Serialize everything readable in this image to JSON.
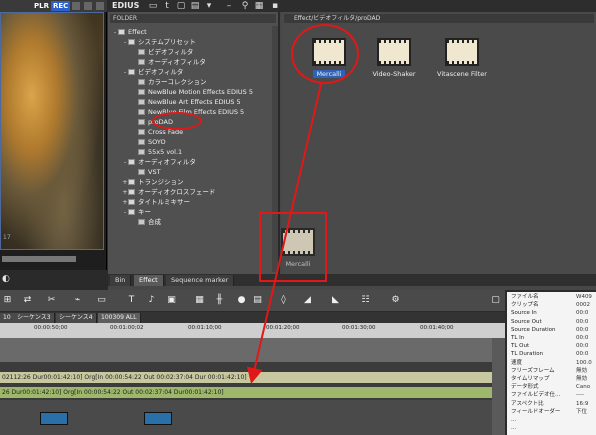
{
  "player": {
    "plr_label": "PLR",
    "rec_label": "REC",
    "frame_number": "17"
  },
  "app": {
    "title": "EDIUS"
  },
  "folder_pane": {
    "header": "FOLDER",
    "items": [
      {
        "label": "Effect",
        "indent": 0,
        "expander": "-"
      },
      {
        "label": "システムプリセット",
        "indent": 1,
        "expander": "-"
      },
      {
        "label": "ビデオフィルタ",
        "indent": 2,
        "expander": ""
      },
      {
        "label": "オーディオフィルタ",
        "indent": 2,
        "expander": ""
      },
      {
        "label": "ビデオフィルタ",
        "indent": 1,
        "expander": "-"
      },
      {
        "label": "カラーコレクション",
        "indent": 2,
        "expander": ""
      },
      {
        "label": "NewBlue Motion Effects EDIUS 5",
        "indent": 2,
        "expander": ""
      },
      {
        "label": "NewBlue Art Effects EDIUS 5",
        "indent": 2,
        "expander": ""
      },
      {
        "label": "NewBlue Film Effects EDIUS 5",
        "indent": 2,
        "expander": ""
      },
      {
        "label": "proDAD",
        "indent": 2,
        "expander": ""
      },
      {
        "label": "Cross Fade",
        "indent": 2,
        "expander": ""
      },
      {
        "label": "SOYO",
        "indent": 2,
        "expander": ""
      },
      {
        "label": "55x5 vol.1",
        "indent": 2,
        "expander": ""
      },
      {
        "label": "オーディオフィルタ",
        "indent": 1,
        "expander": "-"
      },
      {
        "label": "VST",
        "indent": 2,
        "expander": ""
      },
      {
        "label": "トランジション",
        "indent": 1,
        "expander": "+"
      },
      {
        "label": "オーディオクロスフェード",
        "indent": 1,
        "expander": "+"
      },
      {
        "label": "タイトルミキサー",
        "indent": 1,
        "expander": "+"
      },
      {
        "label": "キー",
        "indent": 1,
        "expander": "-"
      },
      {
        "label": "合成",
        "indent": 2,
        "expander": ""
      }
    ]
  },
  "effects_pane": {
    "path": "Effect/ビデオフィルタ/proDAD",
    "items": [
      {
        "label": "Mercalli",
        "selected": true
      },
      {
        "label": "Video-Shaker",
        "selected": false
      },
      {
        "label": "Vitascene Filter",
        "selected": false
      }
    ],
    "drag_ghost_label": "Mercalli"
  },
  "bin_tabs": [
    {
      "label": "Bin",
      "active": false
    },
    {
      "label": "Effect",
      "active": true
    },
    {
      "label": "Sequence marker",
      "active": false
    }
  ],
  "timeline": {
    "sequence_tabs": [
      {
        "label": "10",
        "active": false
      },
      {
        "label": "シーケンス3",
        "active": false
      },
      {
        "label": "シーケンス4",
        "active": false
      },
      {
        "label": "100309 ALL",
        "active": true
      }
    ],
    "ruler_ticks": [
      "00:00:50;00",
      "00:01:00;02",
      "00:01:10;00",
      "00:01:20;00",
      "00:01:30;00",
      "00:01:40;00"
    ],
    "video_clip_text": "02112:26 Dur00:01:42:10]  Org[In 00:00:54:22 Out 00:02:37:04 Dur 00:01:42:10]",
    "audio_clip_text": "26 Dur00:01:42:10]  Org[In 00:00:54:22 Out 00:02:37:04 Dur00:01:42:10]"
  },
  "info_panel": {
    "rows": [
      {
        "k": "ファイル名",
        "v": "W409"
      },
      {
        "k": "クリップ名",
        "v": "0002"
      },
      {
        "k": "Source In",
        "v": "00:0"
      },
      {
        "k": "Source Out",
        "v": "00:0"
      },
      {
        "k": "Source Duration",
        "v": "00:0"
      },
      {
        "k": "TL In",
        "v": "00:0"
      },
      {
        "k": "TL Out",
        "v": "00:0"
      },
      {
        "k": "TL Duration",
        "v": "00:0"
      },
      {
        "k": "速度",
        "v": "100.0"
      },
      {
        "k": "フリーズフレーム",
        "v": "無効"
      },
      {
        "k": "タイムリマップ",
        "v": "無効"
      },
      {
        "k": "データ形式",
        "v": "Cano"
      },
      {
        "k": "ファイルビデオ仕...",
        "v": "----"
      },
      {
        "k": "アスペクト比",
        "v": "16:9"
      },
      {
        "k": "フィールドオーダー",
        "v": "下位"
      },
      {
        "k": "...",
        "v": ""
      },
      {
        "k": "...",
        "v": ""
      }
    ]
  },
  "colors": {
    "annotation_red": "#e01818",
    "selection_blue": "#2e62b8",
    "video_clip": "#c8c8a0",
    "audio_clip": "#9db86a"
  }
}
